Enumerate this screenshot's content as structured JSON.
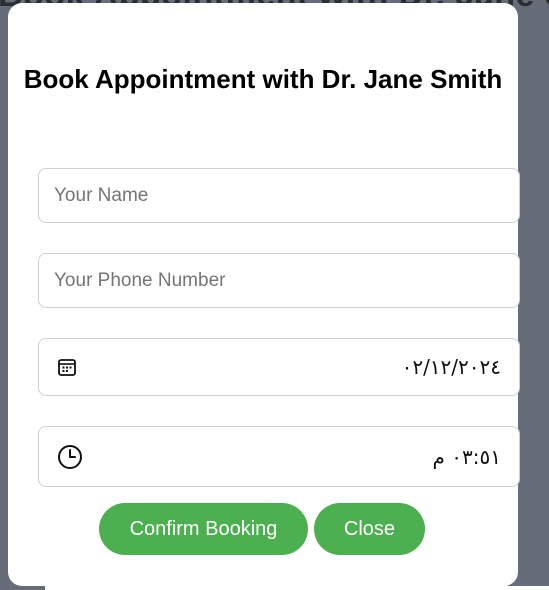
{
  "background": {
    "title_fragment": "Book Appointment with Dr. Jane Smith"
  },
  "modal": {
    "title": "Book Appointment with Dr. Jane Smith",
    "name_placeholder": "Your Name",
    "phone_placeholder": "Your Phone Number",
    "date_value": "٠٢/١٢/٢٠٢٤",
    "time_value": "٠٣:٥١ م",
    "confirm_label": "Confirm Booking",
    "close_label": "Close"
  },
  "icons": {
    "date": "calendar-icon",
    "time": "clock-icon"
  },
  "colors": {
    "accent": "#4caf50",
    "backdrop": "#676d78"
  }
}
